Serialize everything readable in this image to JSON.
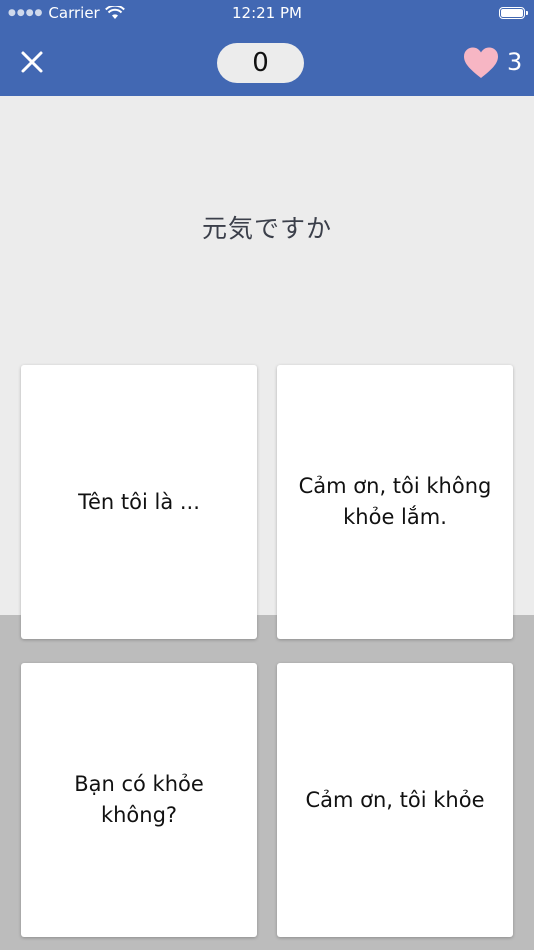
{
  "status_bar": {
    "carrier": "Carrier",
    "time": "12:21 PM",
    "signal_icon": "signal-dots",
    "wifi_icon": "wifi-icon",
    "battery_icon": "battery-icon"
  },
  "header": {
    "close_icon": "close-icon",
    "score": "0",
    "heart_icon": "heart-icon",
    "lives": "3",
    "colors": {
      "bar": "#4268b3",
      "heart": "#f7b6c4"
    }
  },
  "question": {
    "text": "元気ですか"
  },
  "answers": [
    {
      "label": "Tên tôi là ..."
    },
    {
      "label": "Cảm ơn, tôi không khỏe lắm."
    },
    {
      "label": "Bạn có khỏe không?"
    },
    {
      "label": "Cảm ơn, tôi khỏe"
    }
  ]
}
